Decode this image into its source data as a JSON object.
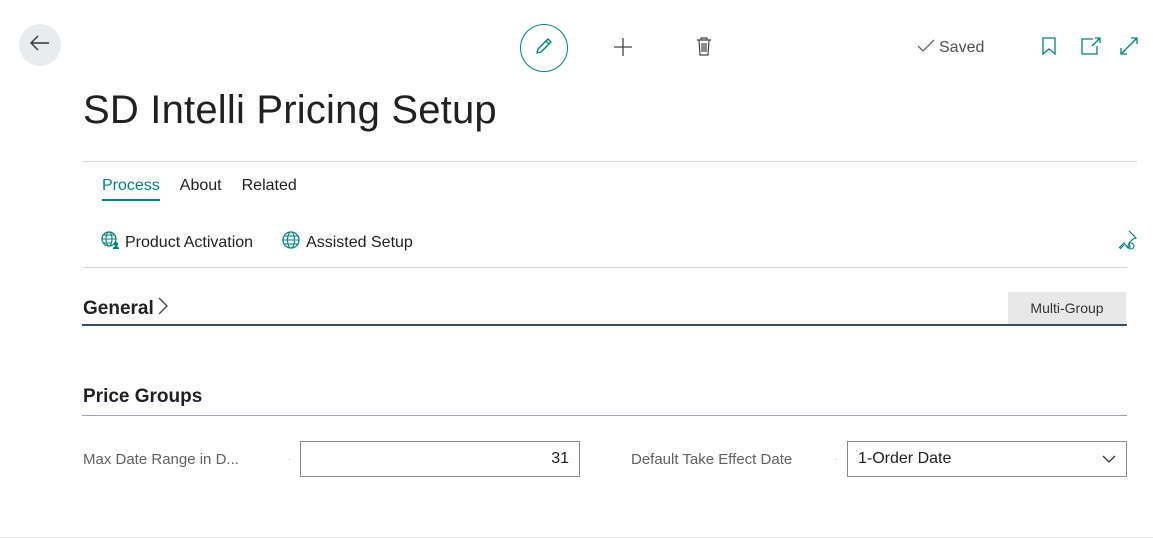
{
  "toolbar": {
    "back_icon": "arrow-left-icon",
    "edit_icon": "pencil-icon",
    "new_icon": "plus-icon",
    "delete_icon": "trash-icon",
    "saved_label": "Saved",
    "bookmark_icon": "bookmark-icon",
    "open_new_window_icon": "open-in-new-window-icon",
    "expand_icon": "expand-icon"
  },
  "page": {
    "title": "SD Intelli Pricing Setup"
  },
  "tabs": [
    {
      "label": "Process",
      "active": true
    },
    {
      "label": "About",
      "active": false
    },
    {
      "label": "Related",
      "active": false
    }
  ],
  "actions": [
    {
      "label": "Product Activation",
      "icon": "globe-user-icon"
    },
    {
      "label": "Assisted Setup",
      "icon": "globe-icon"
    }
  ],
  "pin_icon": "pin-icon",
  "sections": {
    "general": {
      "title": "General",
      "badge": "Multi-Group"
    },
    "price_groups": {
      "title": "Price Groups"
    }
  },
  "fields": {
    "max_date_range": {
      "label": "Max Date Range in D...",
      "value": "31"
    },
    "default_take_effect": {
      "label": "Default Take Effect Date",
      "value": "1-Order Date"
    }
  },
  "colors": {
    "accent": "#00857c",
    "section_line": "#3d4c5f"
  }
}
